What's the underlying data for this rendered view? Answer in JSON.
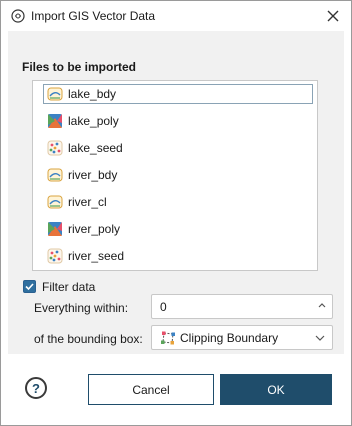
{
  "window": {
    "title": "Import GIS Vector Data",
    "icon": "app-logo-icon",
    "close_icon": "close-icon"
  },
  "files": {
    "section_title": "Files to be imported",
    "items": [
      {
        "label": "lake_bdy",
        "icon": "polyline-icon",
        "selected": true
      },
      {
        "label": "lake_poly",
        "icon": "polygon-icon",
        "selected": false
      },
      {
        "label": "lake_seed",
        "icon": "points-icon",
        "selected": false
      },
      {
        "label": "river_bdy",
        "icon": "polyline-icon",
        "selected": false
      },
      {
        "label": "river_cl",
        "icon": "polyline-icon",
        "selected": false
      },
      {
        "label": "river_poly",
        "icon": "polygon-icon",
        "selected": false
      },
      {
        "label": "river_seed",
        "icon": "points-icon",
        "selected": false
      }
    ]
  },
  "filter": {
    "label": "Filter data",
    "checked": true,
    "within_label": "Everything within:",
    "within_value": "0",
    "bbox_label": "of the bounding box:",
    "bbox_value": "Clipping Boundary",
    "bbox_icon": "clipping-boundary-icon"
  },
  "buttons": {
    "help_label": "?",
    "cancel_label": "Cancel",
    "ok_label": "OK"
  },
  "colors": {
    "primary": "#1f4d6b",
    "checkbox": "#2f6f9f",
    "panel_bg": "#f1f1f1"
  }
}
